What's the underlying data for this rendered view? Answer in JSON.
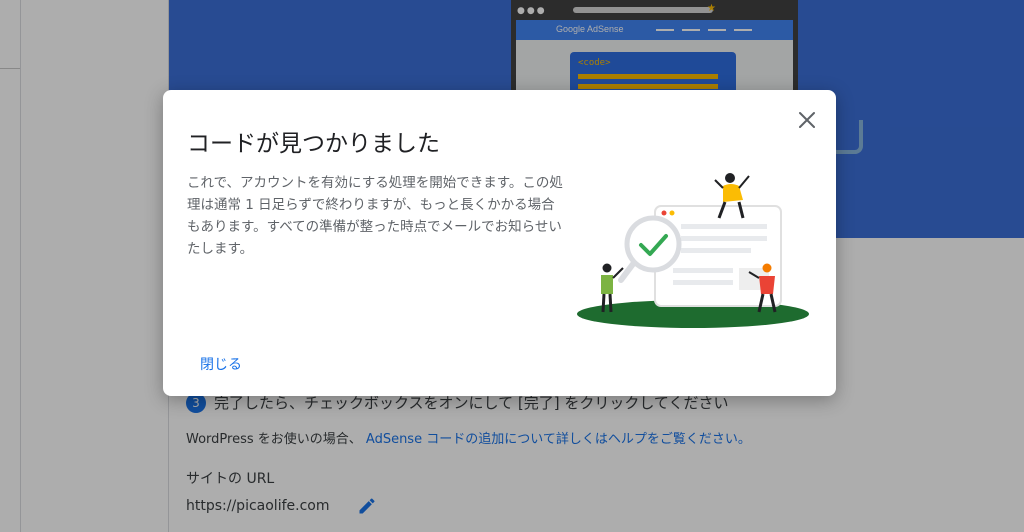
{
  "background": {
    "hero": {
      "brand": "Google AdSense",
      "code_tag": "<code>"
    },
    "step3": {
      "number": "3",
      "text": "完了したら、チェックボックスをオンにして [完了] をクリックしてください"
    },
    "help": {
      "prefix": "WordPress をお使いの場合、",
      "link": "AdSense コードの追加について詳しくはヘルプをご覧ください。"
    },
    "site": {
      "label": "サイトの URL",
      "url": "https://picaolife.com"
    }
  },
  "dialog": {
    "title": "コードが見つかりました",
    "body": "これで、アカウントを有効にする処理を開始できます。この処理は通常 1 日足らずで終わりますが、もっと長くかかる場合もあります。すべての準備が整った時点でメールでお知らせいたします。",
    "close_label": "閉じる"
  },
  "colors": {
    "hero_blue": "#3b6fd8",
    "accent_blue": "#1a73e8",
    "ground_green": "#1e6b2f",
    "check_green": "#34a853",
    "yellow": "#fbbc04"
  },
  "icons": [
    "close-icon",
    "pencil-icon",
    "magnifier-check-icon"
  ]
}
